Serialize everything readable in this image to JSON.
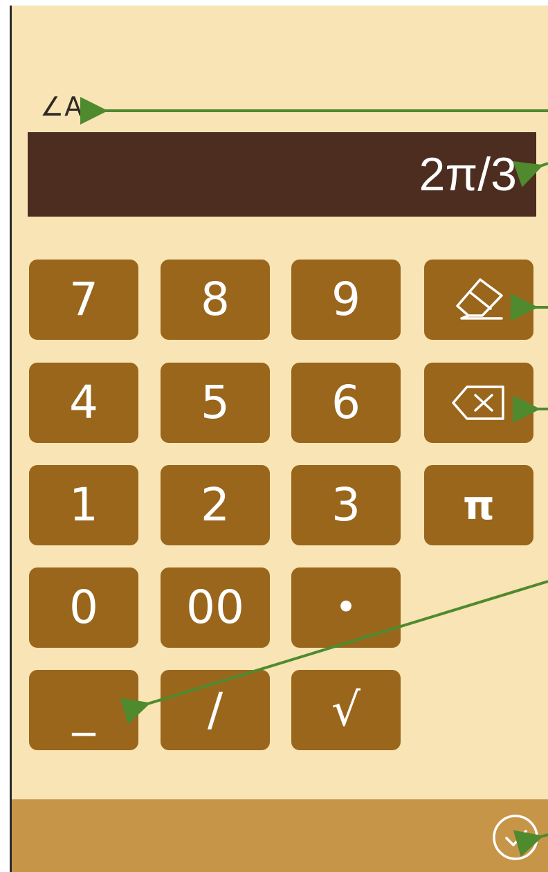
{
  "field": {
    "label": "∠A",
    "value": "2π/3"
  },
  "keypad": {
    "keys": [
      "7",
      "8",
      "9",
      "4",
      "5",
      "6",
      "1",
      "2",
      "3",
      "π",
      "0",
      "00",
      "•",
      "_",
      "/",
      "√"
    ],
    "clear_icon": "eraser-icon",
    "backspace_icon": "backspace-icon"
  },
  "footer": {
    "confirm_icon": "check-circle-icon"
  },
  "colors": {
    "background": "#f8e4b4",
    "display": "#4d2d1f",
    "key": "#99661c",
    "footer": "#c79548",
    "annotation_arrow": "#4f8a2e"
  }
}
